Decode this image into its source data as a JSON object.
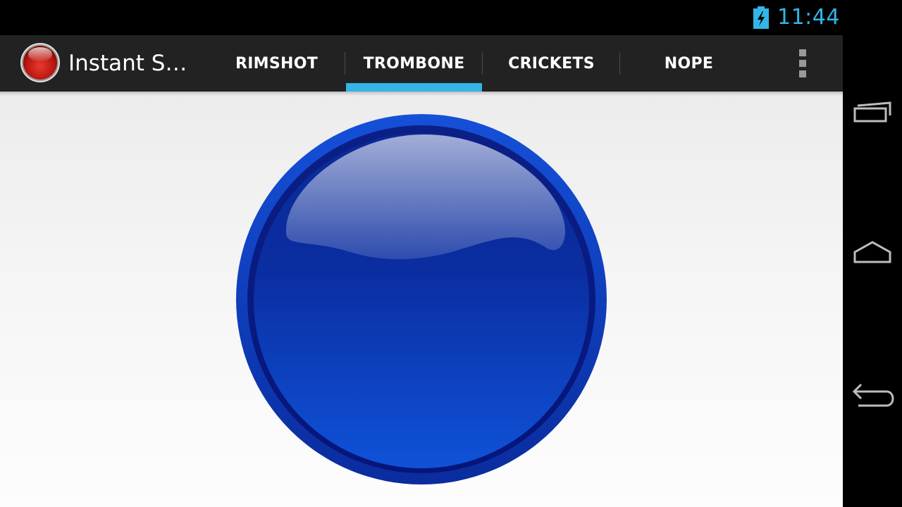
{
  "status_bar": {
    "time": "11:44",
    "battery_icon": "battery-charging-icon",
    "accent_color": "#33b5e5"
  },
  "action_bar": {
    "app_icon": "red-button-icon",
    "app_title": "Instant S…",
    "tabs": [
      {
        "label": "RIMSHOT",
        "selected": false
      },
      {
        "label": "TROMBONE",
        "selected": true
      },
      {
        "label": "CRICKETS",
        "selected": false
      },
      {
        "label": "NOPE",
        "selected": false
      }
    ],
    "overflow_icon": "overflow-menu-icon",
    "indicator_color": "#33b5e5"
  },
  "main": {
    "button_icon": "blue-glossy-button",
    "button_color": "#0a3fc8"
  },
  "nav_bar": {
    "recents_icon": "recent-apps-icon",
    "home_icon": "home-icon",
    "back_icon": "back-icon"
  }
}
